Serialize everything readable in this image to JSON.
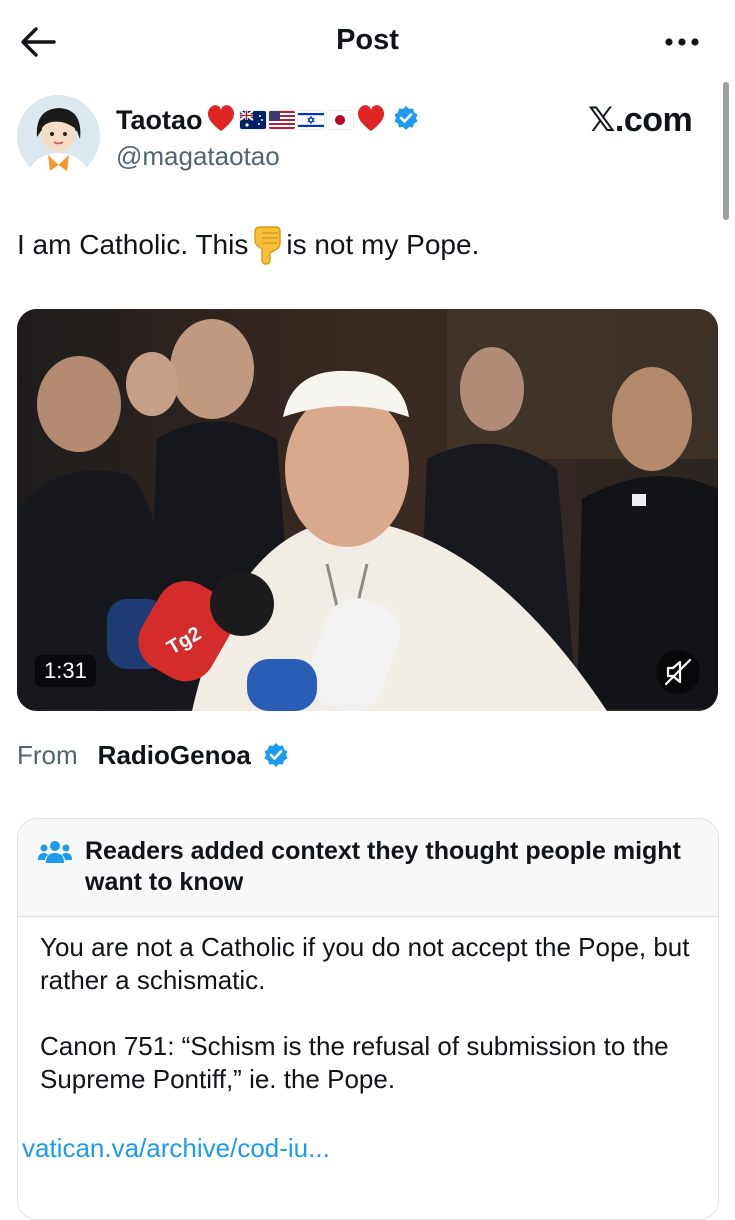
{
  "header": {
    "title": "Post",
    "back_icon": "back-arrow-icon",
    "more_icon": "more-horizontal-icon"
  },
  "post": {
    "author_name": "Taotao",
    "author_emojis": [
      "red-heart",
      "australia-flag",
      "us-flag",
      "israel-flag",
      "japan-flag",
      "red-heart"
    ],
    "handle": "@magataotao",
    "watermark": "𝕏.com",
    "text_before": "I am Catholic. This",
    "text_after": "is not my Pope.",
    "video": {
      "duration": "1:31",
      "muted": true,
      "mic_label": "Tg2"
    },
    "from_label": "From",
    "source_name": "RadioGenoa"
  },
  "community_note": {
    "title": "Readers added context they thought people might want to know",
    "paragraphs": [
      "You are not a Catholic if you do not accept the Pope, but rather a schismatic.",
      "Canon 751: “Schism is the refusal of submission to the Supreme Pontiff,” ie. the Pope."
    ],
    "link": "vatican.va/archive/cod-iu..."
  },
  "colors": {
    "verified": "#1d9bf0",
    "link": "#1d9bf0",
    "muted_text": "#536471",
    "heart": "#e02424"
  }
}
